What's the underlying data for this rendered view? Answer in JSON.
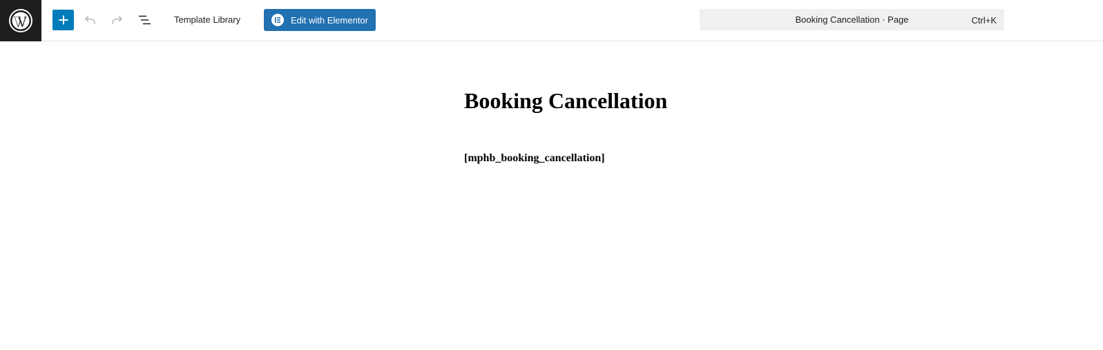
{
  "toolbar": {
    "logo_icon": "wordpress-icon",
    "add_icon": "plus-icon",
    "undo_icon": "undo-icon",
    "redo_icon": "redo-icon",
    "list_view_icon": "list-view-icon",
    "template_library_label": "Template Library",
    "elementor_button_label": "Edit with Elementor",
    "elementor_icon": "elementor-icon",
    "command_bar": {
      "document_title": "Booking Cancellation · Page",
      "shortcut": "Ctrl+K"
    }
  },
  "editor": {
    "post_title": "Booking Cancellation",
    "shortcode": "[mphb_booking_cancellation]"
  },
  "colors": {
    "logo_bg": "#1e1e1e",
    "primary": "#007cba",
    "elementor_button": "#2271b1",
    "command_bar_bg": "#f0f0f0"
  }
}
